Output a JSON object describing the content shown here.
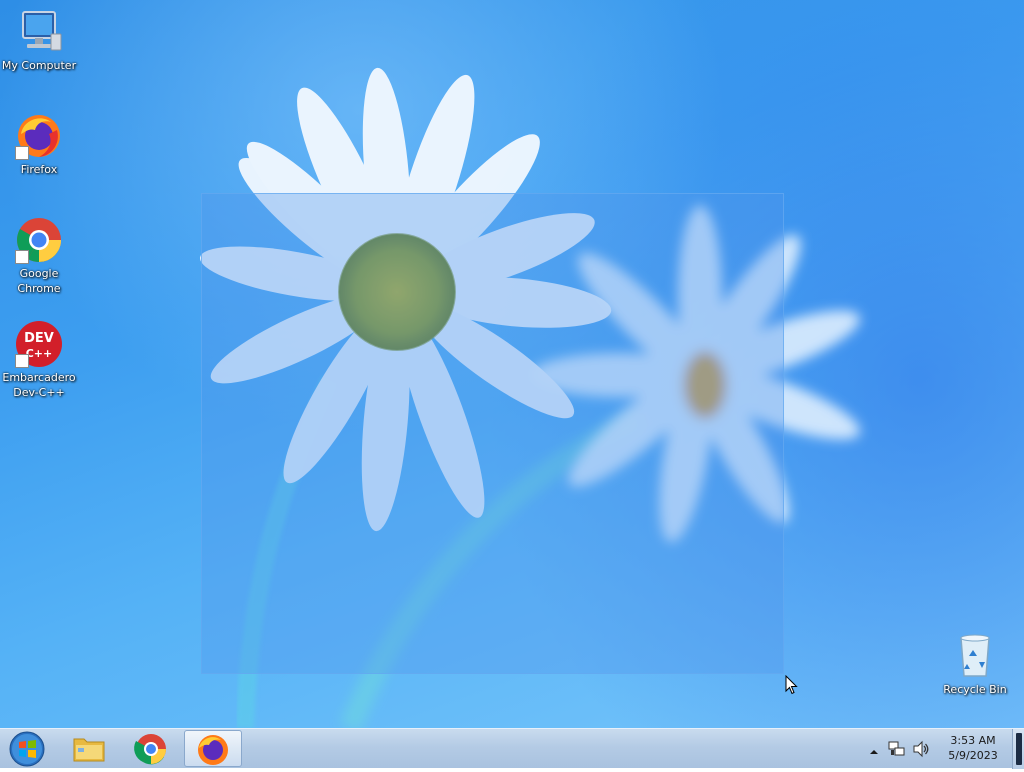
{
  "desktop": {
    "icons": [
      {
        "label": "My Computer",
        "icon": "computer-icon"
      },
      {
        "label": "Firefox",
        "icon": "firefox-icon"
      },
      {
        "label": "Google Chrome",
        "icon": "chrome-icon"
      },
      {
        "label": "Embarcadero Dev-C++",
        "icon": "devcpp-icon",
        "badge": "DEV C++"
      },
      {
        "label": "Recycle Bin",
        "icon": "recycle-bin-icon"
      }
    ]
  },
  "taskbar": {
    "start_icon": "windows-start-orb-icon",
    "pinned": [
      {
        "name": "File Explorer",
        "icon": "folder-icon",
        "active": false
      },
      {
        "name": "Google Chrome",
        "icon": "chrome-icon",
        "active": false
      },
      {
        "name": "Firefox",
        "icon": "firefox-icon",
        "active": true
      }
    ],
    "tray": {
      "icons": [
        "show-hidden-icons-arrow",
        "network-icon",
        "volume-icon"
      ],
      "time": "3:53 AM",
      "date": "5/9/2023"
    }
  },
  "colors": {
    "desktop_blue": "#3d9ef0",
    "taskbar": "#b4cbe5",
    "selection": "#5096eb"
  }
}
